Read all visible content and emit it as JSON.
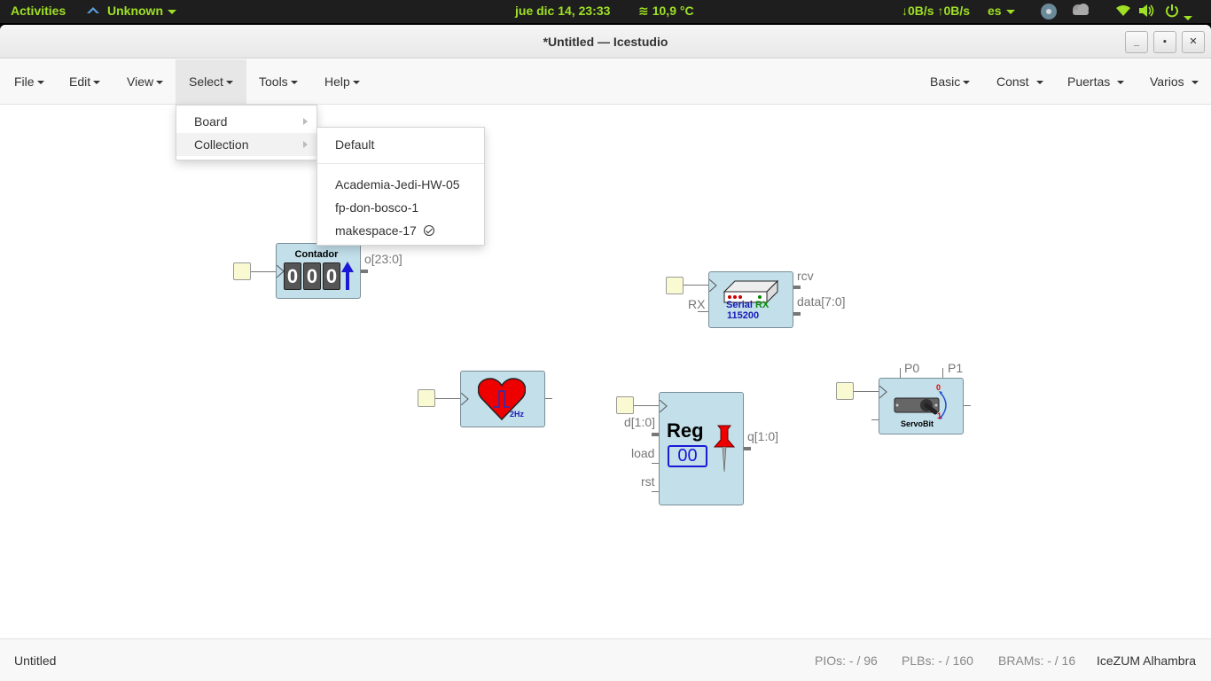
{
  "topbar": {
    "activities": "Activities",
    "network": "Unknown",
    "datetime": "jue dic 14, 23:33",
    "weather": "10,9 °C",
    "netspeed": "↓0B/s ↑0B/s",
    "lang": "es"
  },
  "window": {
    "title": "*Untitled — Icestudio"
  },
  "menubar": {
    "left": [
      "File",
      "Edit",
      "View",
      "Select",
      "Tools",
      "Help"
    ],
    "right": [
      "Basic",
      "Const",
      "Puertas",
      "Varios"
    ]
  },
  "select_menu": {
    "items": [
      "Board",
      "Collection"
    ]
  },
  "collection_menu": {
    "default": "Default",
    "items": [
      "Academia-Jedi-HW-05",
      "fp-don-bosco-1",
      "makespace-17"
    ],
    "checked": "makespace-17"
  },
  "blocks": {
    "contador": {
      "title": "Contador",
      "digits": [
        "0",
        "0",
        "0"
      ],
      "out": "o[23:0]"
    },
    "serial": {
      "line1": "Serial",
      "line2": "RX",
      "baud": "115200",
      "in": "RX",
      "out1": "rcv",
      "out2": "data[7:0]"
    },
    "heart": {
      "freq": "2Hz"
    },
    "reg": {
      "title": "Reg",
      "value": "00",
      "in1": "d[1:0]",
      "in2": "load",
      "in3": "rst",
      "out": "q[1:0]"
    },
    "servo": {
      "label": "ServoBit",
      "p0": "P0",
      "p1": "P1",
      "n0": "0",
      "n1": "1"
    }
  },
  "footer": {
    "filename": "Untitled",
    "pios": "PIOs:  - / 96",
    "plbs": "PLBs:  - / 160",
    "brams": "BRAMs:  - / 16",
    "board": "IceZUM Alhambra"
  },
  "colors": {
    "accent": "#9fe025",
    "block": "#c2dfea",
    "pin": "#fafad2"
  }
}
